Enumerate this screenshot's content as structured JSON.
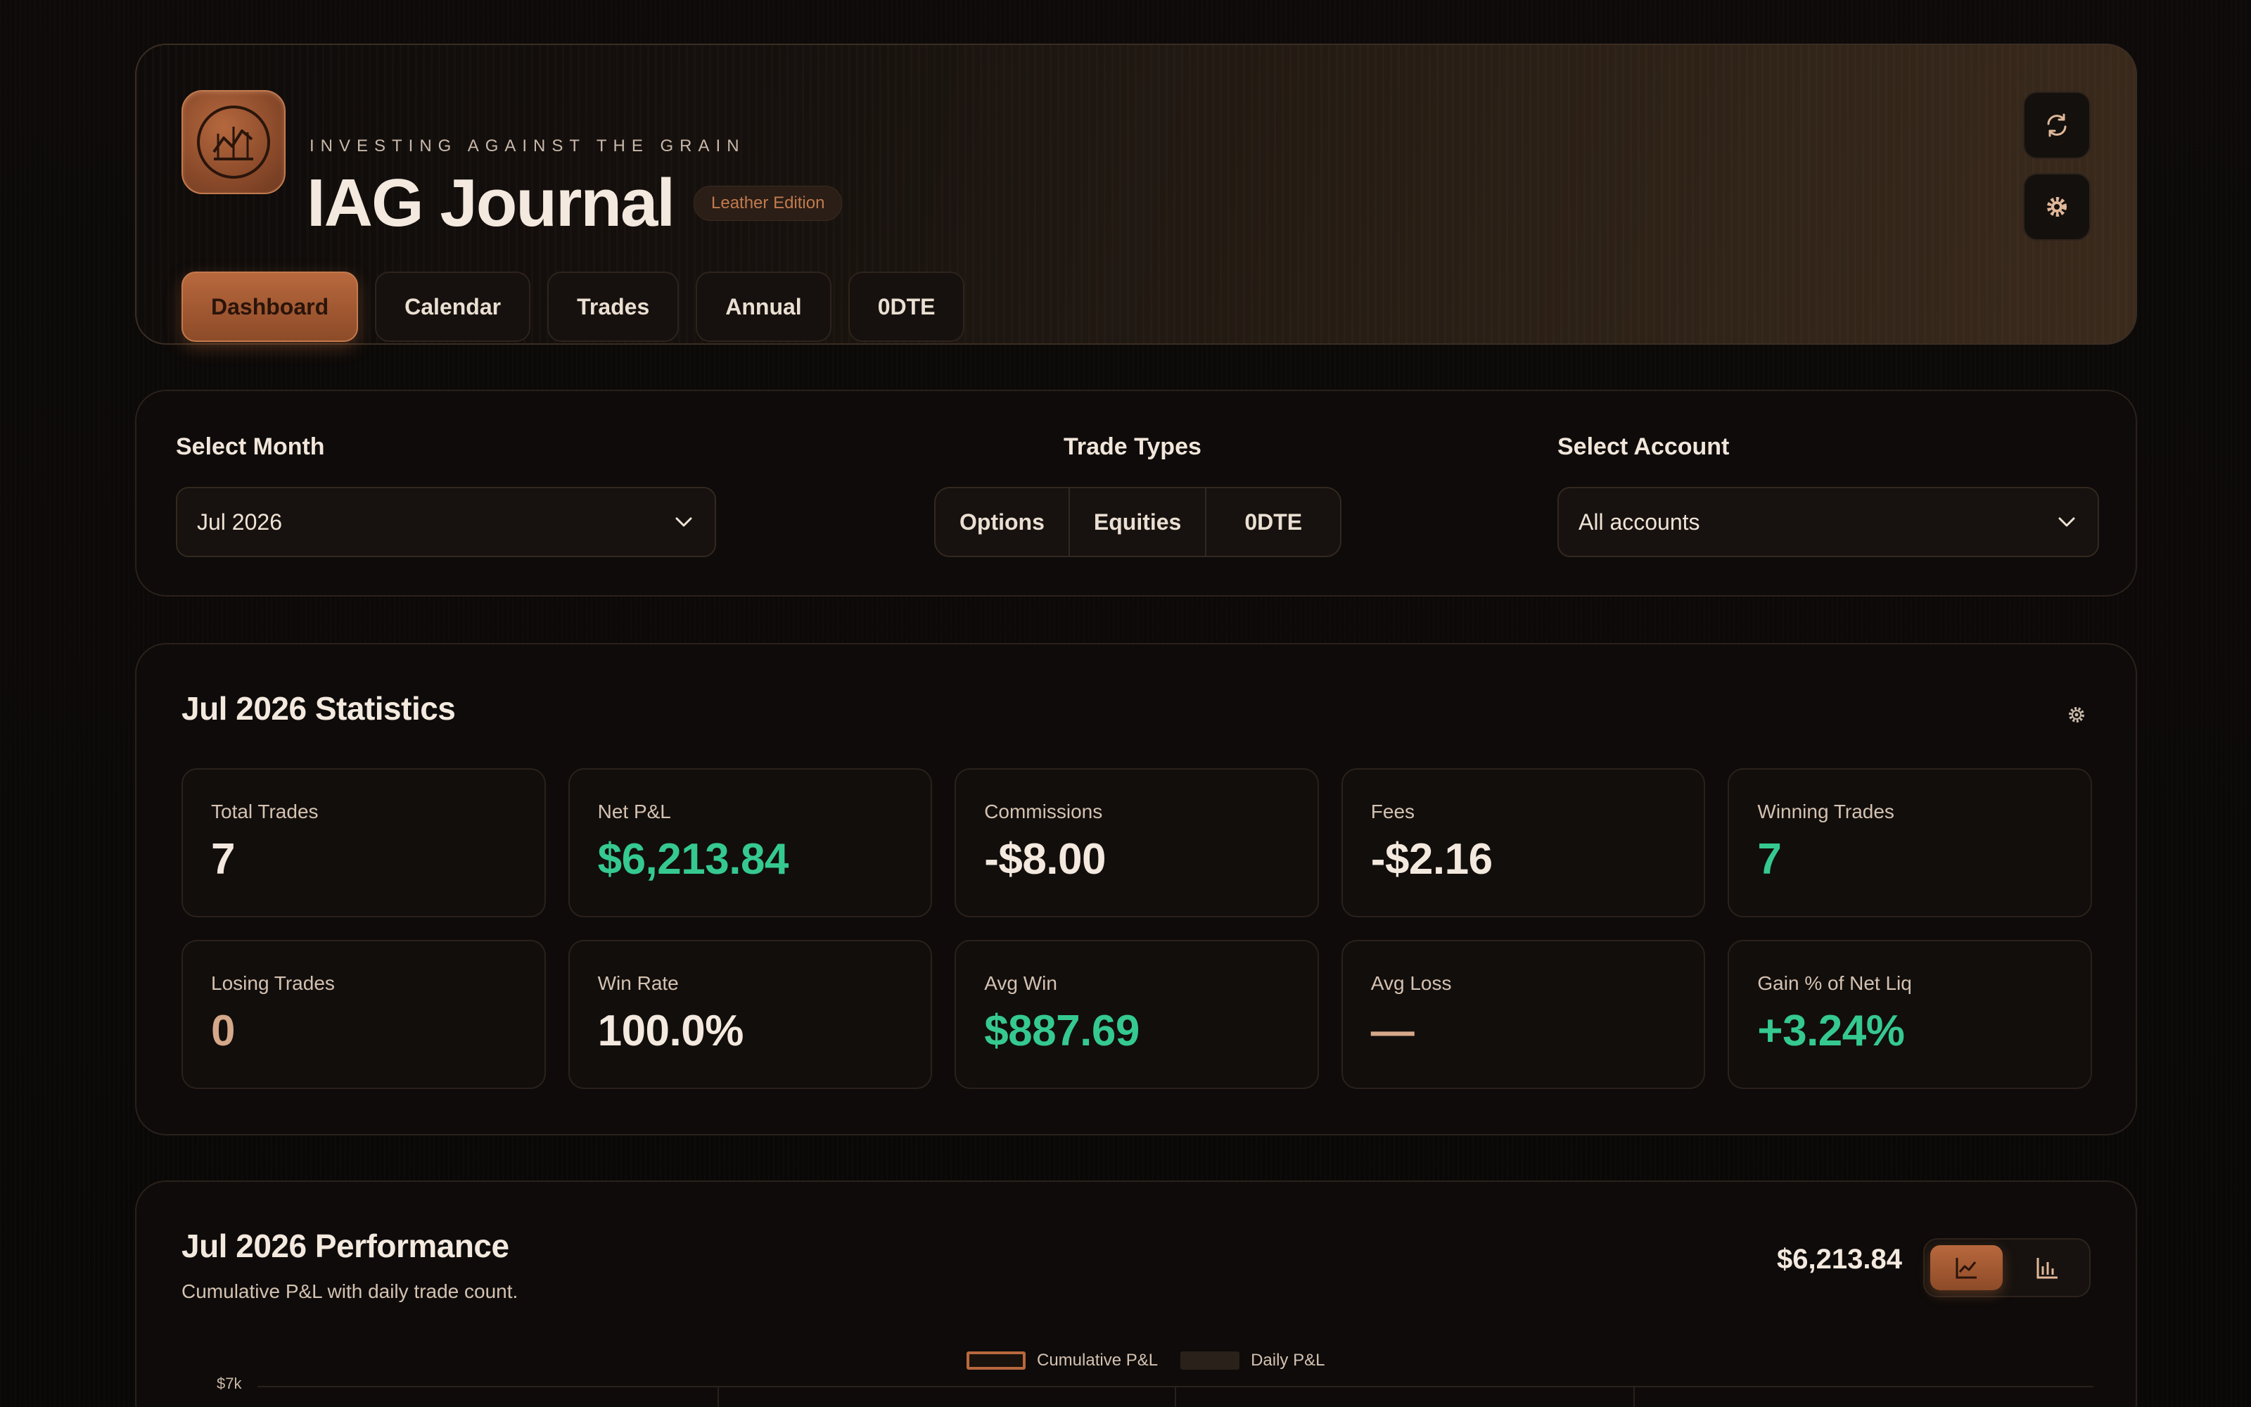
{
  "header": {
    "tagline": "INVESTING AGAINST THE GRAIN",
    "title": "IAG Journal",
    "edition": "Leather Edition",
    "logo_icon": "chart-line-icon",
    "nav": [
      {
        "label": "Dashboard",
        "active": true
      },
      {
        "label": "Calendar",
        "active": false
      },
      {
        "label": "Trades",
        "active": false
      },
      {
        "label": "Annual",
        "active": false
      },
      {
        "label": "0DTE",
        "active": false
      }
    ],
    "actions": [
      "refresh-icon",
      "gear-icon"
    ]
  },
  "filters": {
    "month_label": "Select Month",
    "month_value": "Jul 2026",
    "types_label": "Trade Types",
    "types": [
      "Options",
      "Equities",
      "0DTE"
    ],
    "account_label": "Select Account",
    "account_value": "All accounts"
  },
  "stats": {
    "title": "Jul 2026 Statistics",
    "cards": [
      {
        "label": "Total Trades",
        "value": "7"
      },
      {
        "label": "Net P&L",
        "value": "$6,213.84"
      },
      {
        "label": "Commissions",
        "value": "-$8.00"
      },
      {
        "label": "Fees",
        "value": "-$2.16"
      },
      {
        "label": "Winning Trades",
        "value": "7"
      },
      {
        "label": "Losing Trades",
        "value": "0"
      },
      {
        "label": "Win Rate",
        "value": "100.0%"
      },
      {
        "label": "Avg Win",
        "value": "$887.69"
      },
      {
        "label": "Avg Loss",
        "value": "—"
      },
      {
        "label": "Gain % of Net Liq",
        "value": "+3.24%"
      }
    ]
  },
  "performance": {
    "title": "Jul 2026 Performance",
    "subtitle": "Cumulative P&L with daily trade count.",
    "total": "$6,213.84",
    "legend": [
      "Cumulative P&L",
      "Daily P&L"
    ],
    "y_top_tick": "$7k"
  },
  "colors": {
    "accent": "#b8683d",
    "positive": "#35c990",
    "background": "#0b0908"
  }
}
